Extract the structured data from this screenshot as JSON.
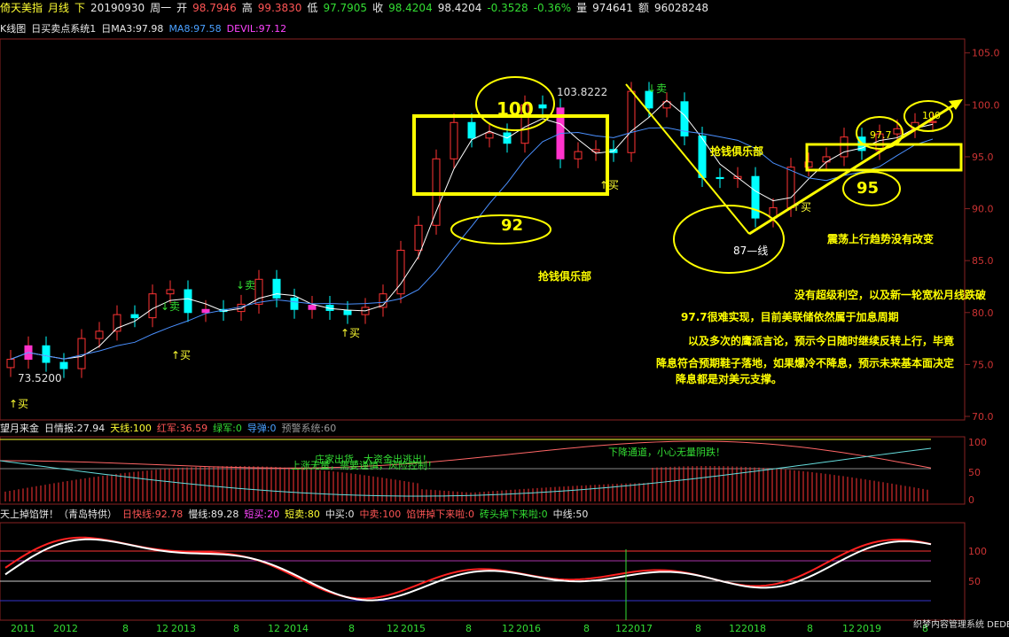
{
  "header": {
    "symbol": "倚天美指",
    "period": "月线",
    "dir": "下",
    "date": "20190930",
    "weekday": "周一",
    "open_label": "开",
    "open": "98.7946",
    "high_label": "高",
    "high": "99.3830",
    "low_label": "低",
    "low": "97.7905",
    "close_label": "收",
    "close": "98.4204",
    "last": "98.4204",
    "change": "-0.3528",
    "change_pct": "-0.36%",
    "volume_label": "量",
    "volume": "974641",
    "amount_label": "额",
    "amount": "96028248"
  },
  "kline_bar": {
    "name": "K线图",
    "system": "日买卖点系统1",
    "ma3": "日MA3:97.98",
    "ma8": "MA8:97.58",
    "devil": "DEVIL:97.12"
  },
  "price_axis": [
    "105.0",
    "100.0",
    "95.0",
    "90.0",
    "85.0",
    "80.0",
    "75.0",
    "70.0"
  ],
  "annotations": {
    "low_price": "73.5200",
    "high_price": "103.8222",
    "buy": "↑买",
    "sell": "↓卖",
    "n100": "100",
    "n92": "92",
    "n87": "87—线",
    "n97_7": "97.7",
    "n95": "95",
    "n100b": "100",
    "club1": "抢钱俱乐部",
    "club2": "抢钱俱乐部",
    "trend": "震荡上行趋势没有改变",
    "comment1": "没有超级利空，以及新一轮宽松月线跌破",
    "comment2": "97.7很难实现，目前美联储依然属于加息周期",
    "comment3": "以及多次的鹰派言论，预示今日随时继续反转上行，毕竟",
    "comment4": "降息符合预期鞋子落地，如果爆冷不降息，预示未来基本面决定",
    "comment5": "降息都是对美元支撑。"
  },
  "panel1": {
    "name": "望月来金",
    "info": "日情报:27.94",
    "tianxian": "天线:100",
    "hongjun": "红军:36.59",
    "lvjun": "绿军:0",
    "daohang": "导弹:0",
    "yujing": "预警系统:60",
    "axis": [
      "100",
      "50",
      "0"
    ],
    "note1": "庄家出货，大资金出逃出！",
    "note2": "上涨无量，需要谨慎，风险控制！",
    "note3": "下降通道，小心无量阴跌！"
  },
  "panel2": {
    "name": "天上掉馅饼！（青岛特供）",
    "kuaixian": "日快线:92.78",
    "manxian": "慢线:89.28",
    "duanmai": "短买:20",
    "duanmai2": "短卖:80",
    "zhongmai": "中买:0",
    "zhongmai2": "中卖:100",
    "xianjing": "馅饼掉下来啦:0",
    "jiaotou": "砖头掉下来啦:0",
    "zhongxian": "中线:50",
    "axis": [
      "100",
      "50"
    ]
  },
  "time_axis": [
    "2011",
    "2012",
    "8",
    "12",
    "2013",
    "8",
    "12",
    "2014",
    "8",
    "12",
    "2015",
    "8",
    "12",
    "2016",
    "8",
    "12",
    "2017",
    "8",
    "12",
    "2018",
    "8",
    "12",
    "2019",
    "8"
  ],
  "watermark": "织梦内容管理系统 DEDECMS.COM",
  "colors": {
    "up": "#ff3333",
    "down": "#00ffff",
    "bg": "#000000",
    "box": "#ffff00",
    "ma": "#ffffff",
    "ma8": "#4a90ff"
  },
  "chart_data": {
    "type": "candlestick",
    "x": [
      "2011-01",
      "2011-03",
      "2011-05",
      "2011-07",
      "2011-09",
      "2011-11",
      "2012-01",
      "2012-03",
      "2012-05",
      "2012-07",
      "2012-09",
      "2012-11",
      "2013-01",
      "2013-03",
      "2013-05",
      "2013-07",
      "2013-09",
      "2013-11",
      "2014-01",
      "2014-03",
      "2014-05",
      "2014-07",
      "2014-09",
      "2014-11",
      "2015-01",
      "2015-03",
      "2015-05",
      "2015-07",
      "2015-09",
      "2015-11",
      "2016-01",
      "2016-03",
      "2016-05",
      "2016-07",
      "2016-09",
      "2016-11",
      "2017-01",
      "2017-03",
      "2017-05",
      "2017-07",
      "2017-09",
      "2017-11",
      "2018-01",
      "2018-03",
      "2018-05",
      "2018-07",
      "2018-09",
      "2018-11",
      "2019-01",
      "2019-03",
      "2019-05",
      "2019-07",
      "2019-09"
    ],
    "close": [
      75.5,
      76.8,
      75.2,
      74.6,
      77.5,
      78.2,
      79.8,
      79.5,
      81.8,
      82.2,
      80.0,
      80.3,
      80.1,
      80.8,
      83.2,
      81.4,
      80.3,
      80.7,
      80.2,
      79.8,
      80.5,
      81.8,
      86.0,
      88.4,
      94.8,
      98.3,
      96.8,
      97.3,
      96.3,
      100.0,
      99.7,
      94.8,
      95.5,
      95.7,
      95.4,
      101.3,
      99.7,
      100.3,
      97.0,
      93.0,
      92.9,
      93.1,
      89.1,
      90.1,
      94.0,
      94.5,
      95.0,
      96.9,
      95.6,
      97.2,
      97.7,
      98.3,
      98.4
    ],
    "ylim": [
      70,
      106
    ]
  }
}
